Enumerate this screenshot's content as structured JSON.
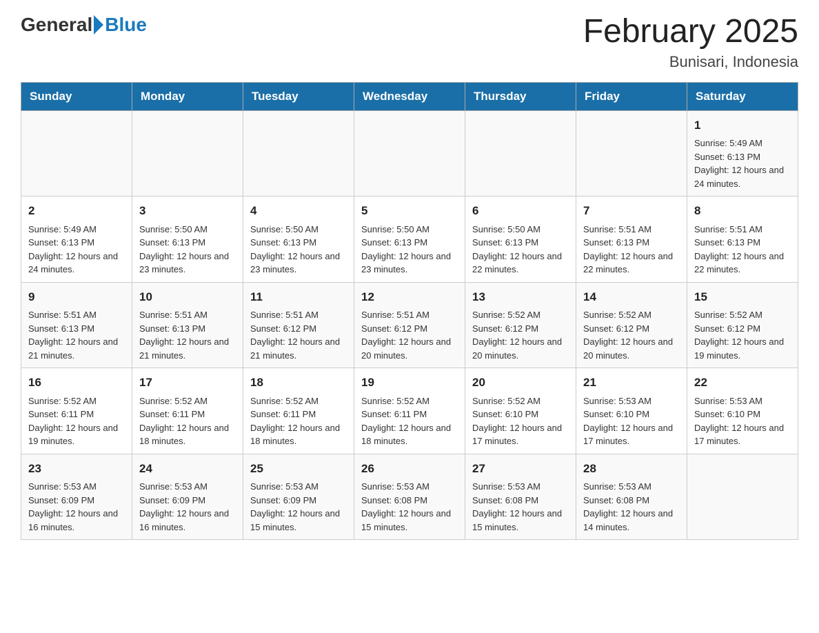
{
  "header": {
    "logo_general": "General",
    "logo_blue": "Blue",
    "month_title": "February 2025",
    "location": "Bunisari, Indonesia"
  },
  "days_of_week": [
    "Sunday",
    "Monday",
    "Tuesday",
    "Wednesday",
    "Thursday",
    "Friday",
    "Saturday"
  ],
  "weeks": [
    [
      {
        "day": "",
        "info": ""
      },
      {
        "day": "",
        "info": ""
      },
      {
        "day": "",
        "info": ""
      },
      {
        "day": "",
        "info": ""
      },
      {
        "day": "",
        "info": ""
      },
      {
        "day": "",
        "info": ""
      },
      {
        "day": "1",
        "info": "Sunrise: 5:49 AM\nSunset: 6:13 PM\nDaylight: 12 hours and 24 minutes."
      }
    ],
    [
      {
        "day": "2",
        "info": "Sunrise: 5:49 AM\nSunset: 6:13 PM\nDaylight: 12 hours and 24 minutes."
      },
      {
        "day": "3",
        "info": "Sunrise: 5:50 AM\nSunset: 6:13 PM\nDaylight: 12 hours and 23 minutes."
      },
      {
        "day": "4",
        "info": "Sunrise: 5:50 AM\nSunset: 6:13 PM\nDaylight: 12 hours and 23 minutes."
      },
      {
        "day": "5",
        "info": "Sunrise: 5:50 AM\nSunset: 6:13 PM\nDaylight: 12 hours and 23 minutes."
      },
      {
        "day": "6",
        "info": "Sunrise: 5:50 AM\nSunset: 6:13 PM\nDaylight: 12 hours and 22 minutes."
      },
      {
        "day": "7",
        "info": "Sunrise: 5:51 AM\nSunset: 6:13 PM\nDaylight: 12 hours and 22 minutes."
      },
      {
        "day": "8",
        "info": "Sunrise: 5:51 AM\nSunset: 6:13 PM\nDaylight: 12 hours and 22 minutes."
      }
    ],
    [
      {
        "day": "9",
        "info": "Sunrise: 5:51 AM\nSunset: 6:13 PM\nDaylight: 12 hours and 21 minutes."
      },
      {
        "day": "10",
        "info": "Sunrise: 5:51 AM\nSunset: 6:13 PM\nDaylight: 12 hours and 21 minutes."
      },
      {
        "day": "11",
        "info": "Sunrise: 5:51 AM\nSunset: 6:12 PM\nDaylight: 12 hours and 21 minutes."
      },
      {
        "day": "12",
        "info": "Sunrise: 5:51 AM\nSunset: 6:12 PM\nDaylight: 12 hours and 20 minutes."
      },
      {
        "day": "13",
        "info": "Sunrise: 5:52 AM\nSunset: 6:12 PM\nDaylight: 12 hours and 20 minutes."
      },
      {
        "day": "14",
        "info": "Sunrise: 5:52 AM\nSunset: 6:12 PM\nDaylight: 12 hours and 20 minutes."
      },
      {
        "day": "15",
        "info": "Sunrise: 5:52 AM\nSunset: 6:12 PM\nDaylight: 12 hours and 19 minutes."
      }
    ],
    [
      {
        "day": "16",
        "info": "Sunrise: 5:52 AM\nSunset: 6:11 PM\nDaylight: 12 hours and 19 minutes."
      },
      {
        "day": "17",
        "info": "Sunrise: 5:52 AM\nSunset: 6:11 PM\nDaylight: 12 hours and 18 minutes."
      },
      {
        "day": "18",
        "info": "Sunrise: 5:52 AM\nSunset: 6:11 PM\nDaylight: 12 hours and 18 minutes."
      },
      {
        "day": "19",
        "info": "Sunrise: 5:52 AM\nSunset: 6:11 PM\nDaylight: 12 hours and 18 minutes."
      },
      {
        "day": "20",
        "info": "Sunrise: 5:52 AM\nSunset: 6:10 PM\nDaylight: 12 hours and 17 minutes."
      },
      {
        "day": "21",
        "info": "Sunrise: 5:53 AM\nSunset: 6:10 PM\nDaylight: 12 hours and 17 minutes."
      },
      {
        "day": "22",
        "info": "Sunrise: 5:53 AM\nSunset: 6:10 PM\nDaylight: 12 hours and 17 minutes."
      }
    ],
    [
      {
        "day": "23",
        "info": "Sunrise: 5:53 AM\nSunset: 6:09 PM\nDaylight: 12 hours and 16 minutes."
      },
      {
        "day": "24",
        "info": "Sunrise: 5:53 AM\nSunset: 6:09 PM\nDaylight: 12 hours and 16 minutes."
      },
      {
        "day": "25",
        "info": "Sunrise: 5:53 AM\nSunset: 6:09 PM\nDaylight: 12 hours and 15 minutes."
      },
      {
        "day": "26",
        "info": "Sunrise: 5:53 AM\nSunset: 6:08 PM\nDaylight: 12 hours and 15 minutes."
      },
      {
        "day": "27",
        "info": "Sunrise: 5:53 AM\nSunset: 6:08 PM\nDaylight: 12 hours and 15 minutes."
      },
      {
        "day": "28",
        "info": "Sunrise: 5:53 AM\nSunset: 6:08 PM\nDaylight: 12 hours and 14 minutes."
      },
      {
        "day": "",
        "info": ""
      }
    ]
  ]
}
